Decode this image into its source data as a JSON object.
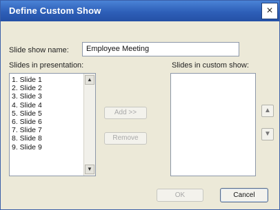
{
  "dialog": {
    "title": "Define Custom Show",
    "close_icon": "×"
  },
  "form": {
    "slide_show_name_label": "Slide show name:",
    "slide_show_name_value": "Employee Meeting",
    "slides_in_presentation_label": "Slides in presentation:",
    "slides_in_custom_show_label": "Slides in custom show:",
    "presentation_slides": [
      "1. Slide 1",
      "2. Slide 2",
      "3. Slide 3",
      "4. Slide 4",
      "5. Slide 5",
      "6. Slide 6",
      "7. Slide 7",
      "8. Slide 8",
      "9. Slide 9"
    ],
    "custom_show_slides": []
  },
  "buttons": {
    "add": "Add >>",
    "remove": "Remove",
    "ok": "OK",
    "cancel": "Cancel",
    "move_up_icon": "up-arrow-icon",
    "move_down_icon": "down-arrow-icon"
  }
}
